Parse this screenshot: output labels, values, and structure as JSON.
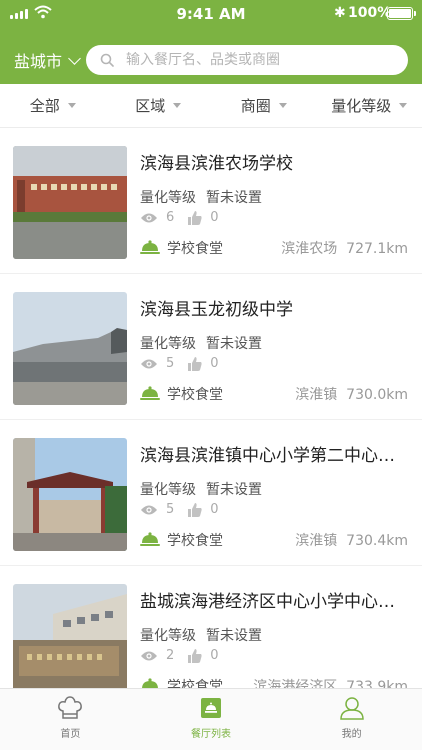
{
  "status": {
    "time": "9:41 AM",
    "battery": "100%"
  },
  "header": {
    "city": "盐城市",
    "search_placeholder": "输入餐厅名、品类或商圈"
  },
  "filters": [
    "全部",
    "区域",
    "商圈",
    "量化等级"
  ],
  "list": [
    {
      "name": "滨海县滨淮农场学校",
      "grade_label": "量化等级",
      "grade_value": "暂未设置",
      "views": "6",
      "likes": "0",
      "category": "学校食堂",
      "location": "滨淮农场",
      "distance": "727.1km"
    },
    {
      "name": "滨海县玉龙初级中学",
      "grade_label": "量化等级",
      "grade_value": "暂未设置",
      "views": "5",
      "likes": "0",
      "category": "学校食堂",
      "location": "滨淮镇",
      "distance": "730.0km"
    },
    {
      "name": "滨海县滨淮镇中心小学第二中心…",
      "grade_label": "量化等级",
      "grade_value": "暂未设置",
      "views": "5",
      "likes": "0",
      "category": "学校食堂",
      "location": "滨淮镇",
      "distance": "730.4km"
    },
    {
      "name": "盐城滨海港经济区中心小学中心…",
      "grade_label": "量化等级",
      "grade_value": "暂未设置",
      "views": "2",
      "likes": "0",
      "category": "学校食堂",
      "location": "滨海港经济区",
      "distance": "733.9km"
    }
  ],
  "tabs": [
    {
      "label": "首页",
      "icon": "chef-hat-icon"
    },
    {
      "label": "餐厅列表",
      "icon": "restaurant-list-icon"
    },
    {
      "label": "我的",
      "icon": "user-icon"
    }
  ],
  "colors": {
    "accent": "#7cb342",
    "text": "#333333",
    "muted": "#999999"
  }
}
